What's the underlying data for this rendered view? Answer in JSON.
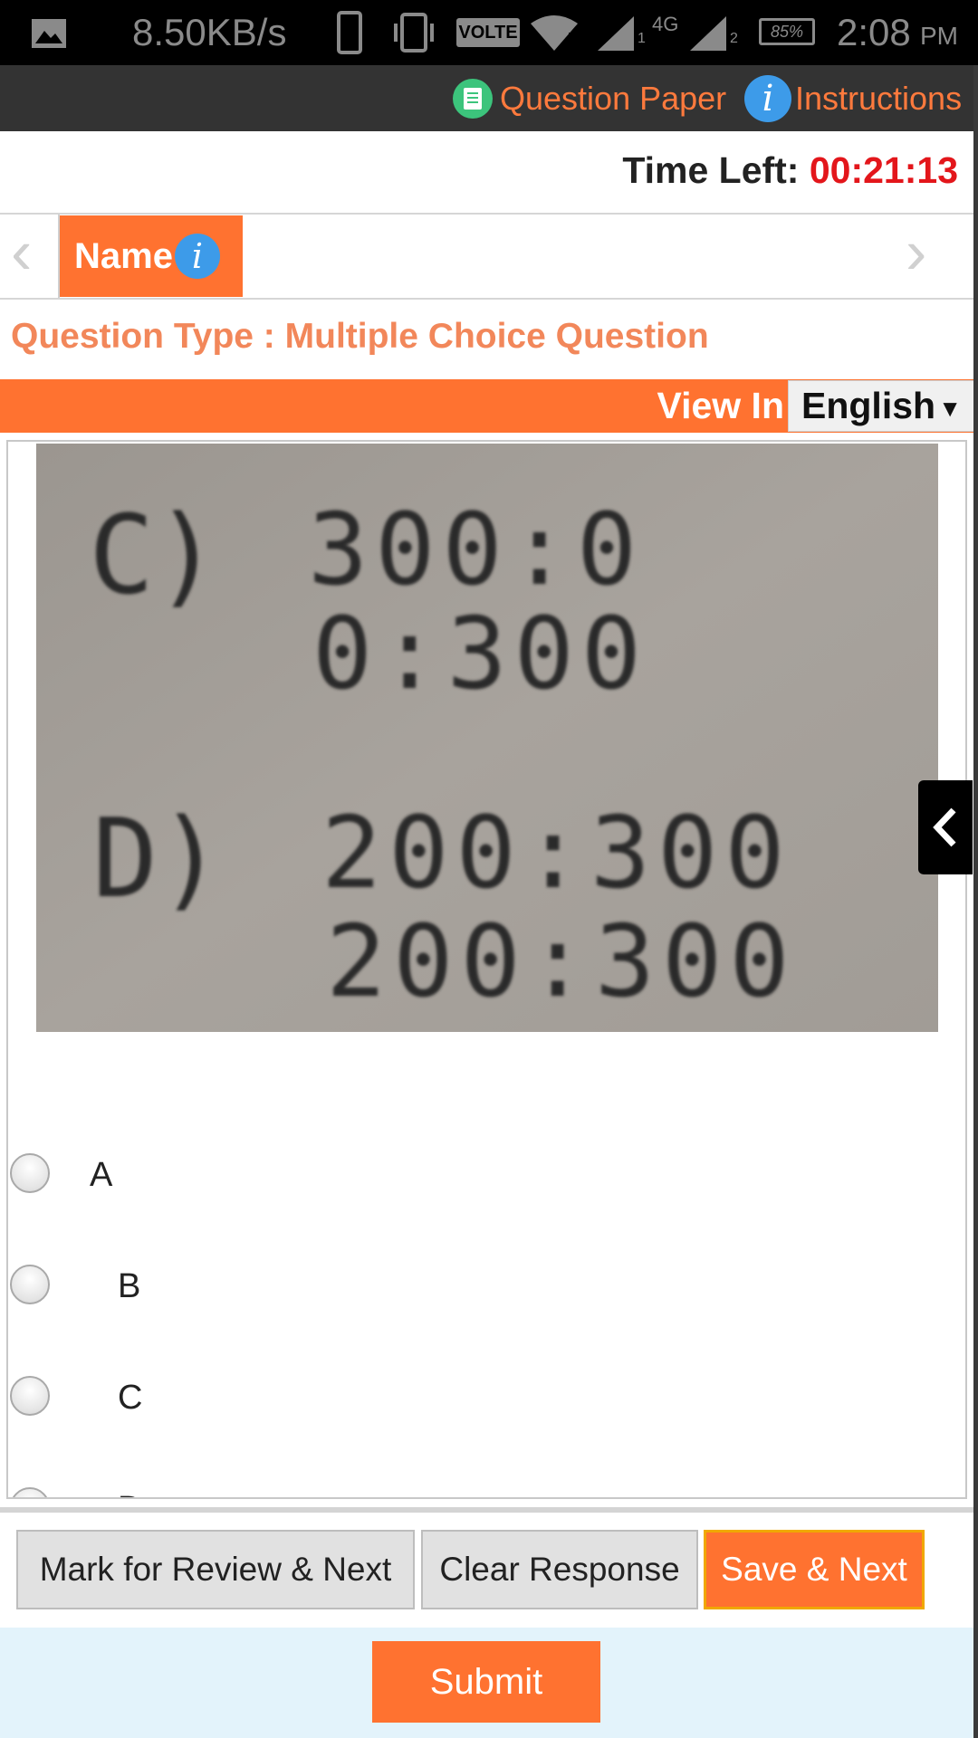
{
  "status_bar": {
    "speed": "8.50KB/s",
    "volte": "VOLTE",
    "network": "4G",
    "sim1": "1",
    "sim2": "2",
    "battery": "85%",
    "time": "2:08",
    "ampm": "PM",
    "icons": [
      "gallery-icon",
      "phone-icon",
      "vibrate-icon",
      "wifi-alert-icon",
      "signal-icon",
      "battery-icon"
    ]
  },
  "header": {
    "question_paper_label": "Question Paper",
    "instructions_label": "Instructions",
    "instructions_icon_glyph": "i"
  },
  "timer": {
    "label": "Time Left:",
    "value": "00:21:13"
  },
  "section_tabs": {
    "prev_glyph": "‹",
    "next_glyph": "›",
    "active_tab_label": "Name",
    "info_glyph": "i"
  },
  "question": {
    "type_text": "Question Type : Multiple Choice Question",
    "view_in_label": "View In",
    "language": "English",
    "language_arrow": "▼",
    "image_text": {
      "c_label": "C)",
      "c_line1": "300:0",
      "c_line2": "0:300",
      "d_label": "D)",
      "d_line1": "200:300",
      "d_line2": "200:300"
    },
    "options": [
      "A",
      "B",
      "C",
      "D"
    ]
  },
  "actions": {
    "mark_review": "Mark for Review & Next",
    "clear_response": "Clear Response",
    "save_next": "Save & Next",
    "submit": "Submit"
  },
  "colors": {
    "accent": "#ff7230",
    "header_bg": "#333333",
    "timer_value": "#e3161b",
    "qtype_text": "#f2875a",
    "submit_area_bg": "#e3f3fb"
  }
}
